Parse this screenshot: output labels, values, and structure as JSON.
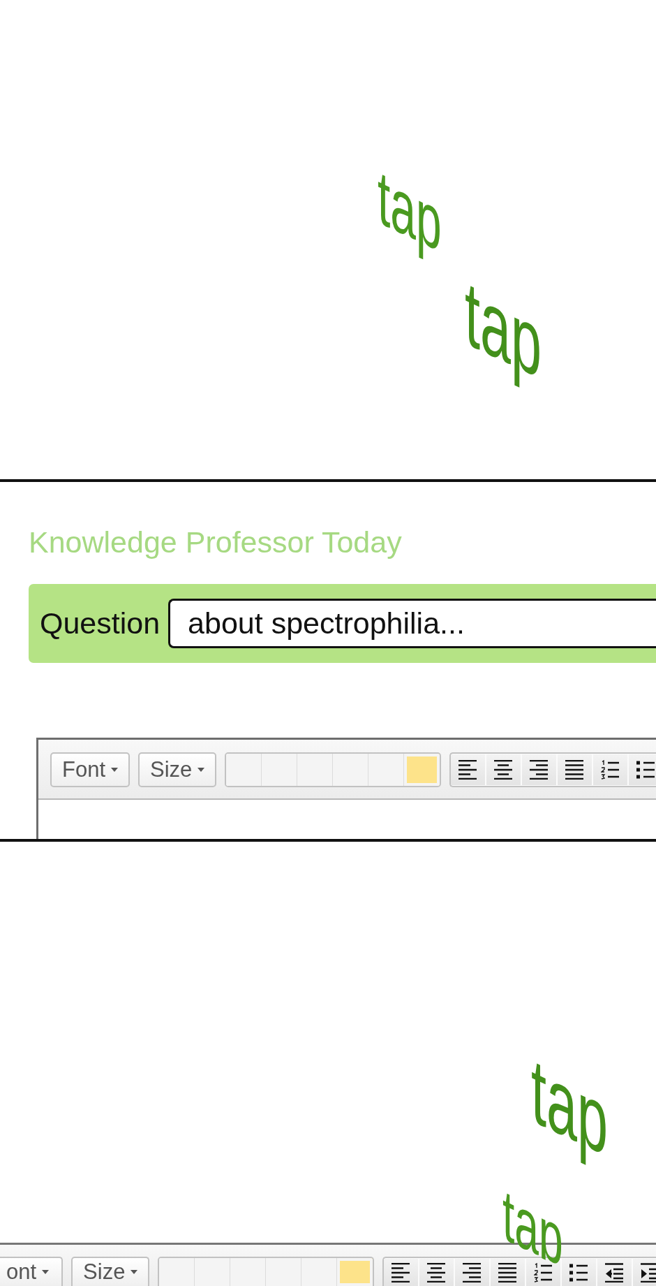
{
  "panel_1": {
    "sound_effects": [
      "tap",
      "tap"
    ]
  },
  "panel_2": {
    "page_title": "Knowledge Professor Today",
    "question_bar": {
      "label": "Question",
      "value": "about spectrophilia..."
    },
    "editor_toolbar": {
      "dropdowns": [
        "Font",
        "Size"
      ],
      "swatches": [
        {
          "color": "#f4f4f4"
        },
        {
          "color": "#f4f4f4"
        },
        {
          "color": "#f4f4f4"
        },
        {
          "color": "#f4f4f4"
        },
        {
          "color": "#f4f4f4"
        },
        {
          "color": "#fde38a"
        }
      ],
      "format_buttons": [
        {
          "kind": "align_left"
        },
        {
          "kind": "align_center"
        },
        {
          "kind": "align_right"
        },
        {
          "kind": "justify"
        },
        {
          "kind": "numbered_list"
        },
        {
          "kind": "bulleted_list"
        }
      ]
    }
  },
  "panel_3": {
    "sound_effects": [
      "tap",
      "tap"
    ],
    "editor_toolbar": {
      "dropdowns": [
        "ont",
        "Size"
      ],
      "swatches": [
        {
          "color": "#f4f4f4"
        },
        {
          "color": "#f4f4f4"
        },
        {
          "color": "#f4f4f4"
        },
        {
          "color": "#f4f4f4"
        },
        {
          "color": "#f4f4f4"
        },
        {
          "color": "#fde38a"
        }
      ],
      "format_buttons": [
        {
          "kind": "align_left"
        },
        {
          "kind": "align_center"
        },
        {
          "kind": "align_right"
        },
        {
          "kind": "justify"
        },
        {
          "kind": "numbered_list"
        },
        {
          "kind": "bulleted_list"
        },
        {
          "kind": "outdent"
        },
        {
          "kind": "indent"
        }
      ]
    }
  }
}
